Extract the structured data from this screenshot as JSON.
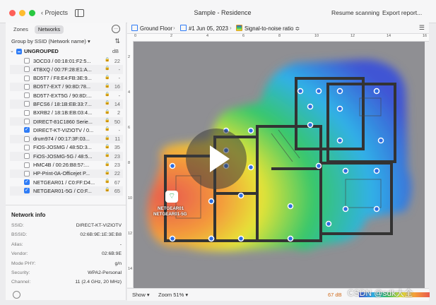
{
  "window": {
    "title": "Sample - Residence",
    "back_label": "Projects",
    "resume_label": "Resume scanning",
    "export_label": "Export report..."
  },
  "sidebar": {
    "tabs": [
      "Zones",
      "Networks"
    ],
    "selected_tab": "Networks",
    "group_by": "Group by SSID (Network name) ▾",
    "group": {
      "label": "UNGROUPED",
      "unit": "dB"
    },
    "networks": [
      {
        "name": "3OCD3 / 00:18:01:F2:5...",
        "value": "22",
        "checked": false
      },
      {
        "name": "4TBXQ / 00:7F:28:E1:A...",
        "value": "-",
        "checked": false
      },
      {
        "name": "BD5T7 / F8:E4:FB:3E:9...",
        "value": "-",
        "checked": false
      },
      {
        "name": "BD5T7-EXT / 90:8D:78...",
        "value": "16",
        "checked": false
      },
      {
        "name": "BD5T7-EXT5G / 90:8D:...",
        "value": "-",
        "checked": false
      },
      {
        "name": "BFCS6 / 18:1B:EB:33:7...",
        "value": "14",
        "checked": false
      },
      {
        "name": "BXRB2 / 18:1B:EB:03:4...",
        "value": "2",
        "checked": false
      },
      {
        "name": "DIRECT-81C1860 Serie...",
        "value": "50",
        "checked": false
      },
      {
        "name": "DIRECT-KT-VIZIOTV / 0...",
        "value": "-",
        "checked": true
      },
      {
        "name": "drum974 / 00:17:3F:03...",
        "value": "11",
        "checked": false
      },
      {
        "name": "FiOS-JOSMG / 48:5D:3...",
        "value": "35",
        "checked": false
      },
      {
        "name": "FiOS-JOSMG-5G / 48:5...",
        "value": "23",
        "checked": false
      },
      {
        "name": "HMC4B / 00:26:B8:57:...",
        "value": "23",
        "checked": false
      },
      {
        "name": "HP-Print-0A-Officejet P...",
        "value": "22",
        "checked": false
      },
      {
        "name": "NETGEAR01 / C0:FF:D4...",
        "value": "67",
        "checked": true
      },
      {
        "name": "NETGEAR01-5G / C0:F...",
        "value": "65",
        "checked": true
      }
    ],
    "info_title": "Network info",
    "info": [
      {
        "key": "SSID:",
        "value": "DIRECT-KT-VIZIOTV"
      },
      {
        "key": "BSSID:",
        "value": "02:6B:9E:1E:3E:B8"
      },
      {
        "key": "Alias:",
        "value": "-"
      },
      {
        "key": "Vendor:",
        "value": "02:6B:9E"
      },
      {
        "key": "Mode PHY:",
        "value": "g/n"
      },
      {
        "key": "Security:",
        "value": "WPA2-Personal"
      },
      {
        "key": "Channel:",
        "value": "11 (2.4 GHz, 20 MHz)"
      }
    ]
  },
  "breadcrumb": {
    "floor": "Ground Floor",
    "survey": "#1 Jun 05, 2023",
    "metric": "Signal-to-noise ratio ≎"
  },
  "ruler": {
    "x_ticks": [
      "0",
      "2",
      "4",
      "6",
      "8",
      "10",
      "12",
      "14",
      "16"
    ],
    "y_ticks": [
      "2",
      "4",
      "6",
      "8",
      "10",
      "12",
      "14"
    ]
  },
  "access_point": {
    "line1": "NETGEAR01",
    "line2": "NETGEAR01-5G"
  },
  "bottom": {
    "show_label": "Show ▾",
    "zoom_label": "Zoom 51% ▾",
    "legend_value": "67 dB"
  },
  "watermark": "CSDN @sdk大全",
  "colors": {
    "accent": "#2f7cf6",
    "heat_low": "#3f55d4",
    "heat_high": "#e85a4f"
  }
}
